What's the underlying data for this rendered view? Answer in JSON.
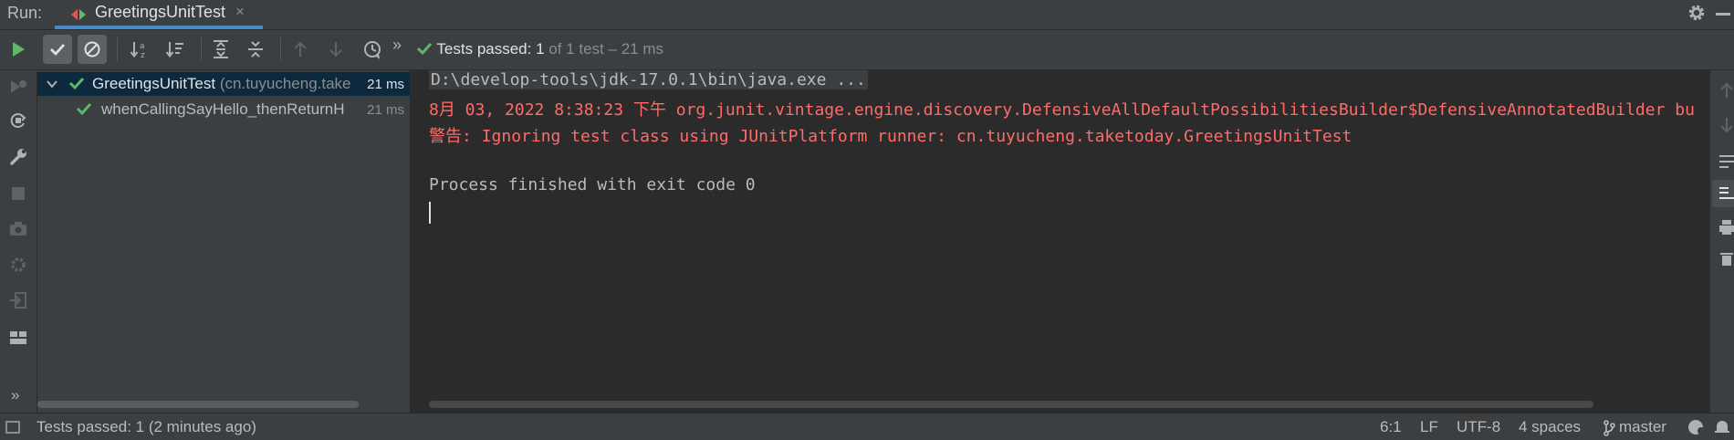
{
  "run_bar": {
    "label": "Run:",
    "tab_title": "GreetingsUnitTest",
    "tab_close": "×"
  },
  "toolbar": {
    "more": "»",
    "status_passed": "Tests passed: 1",
    "status_of": "of 1 test",
    "status_sep": "–",
    "status_time": "21 ms"
  },
  "left_tools": {
    "more": "»"
  },
  "tree": {
    "root": {
      "name": "GreetingsUnitTest",
      "package": "(cn.tuyucheng.take",
      "duration": "21 ms"
    },
    "child": {
      "name": "whenCallingSayHello_thenReturnH",
      "duration": "21 ms"
    }
  },
  "console": {
    "cmd": "D:\\develop-tools\\jdk-17.0.1\\bin\\java.exe ...",
    "line1_date": "8月 03, 2022 8:38:23 下午",
    "line1_text": "org.junit.vintage.engine.discovery.DefensiveAllDefaultPossibilitiesBuilder$DefensiveAnnotatedBuilder bu",
    "line2_prefix": "警告:",
    "line2_text": "Ignoring test class using JUnitPlatform runner: cn.tuyucheng.taketoday.GreetingsUnitTest",
    "exit": "Process finished with exit code 0"
  },
  "status_bar": {
    "message": "Tests passed: 1 (2 minutes ago)",
    "position": "6:1",
    "line_sep": "LF",
    "encoding": "UTF-8",
    "indent": "4 spaces",
    "branch": "master"
  },
  "colors": {
    "pass_green": "#5fb865",
    "error_red": "#ff6b68",
    "selection": "#0d293e",
    "accent_blue": "#4a88c7"
  },
  "icons": [
    "run-icon",
    "check-filter-icon",
    "ignored-filter-icon",
    "sort-alpha-icon",
    "sort-duration-icon",
    "expand-all-icon",
    "collapse-all-icon",
    "up-arrow-icon",
    "down-arrow-icon",
    "history-icon",
    "gear-icon"
  ]
}
